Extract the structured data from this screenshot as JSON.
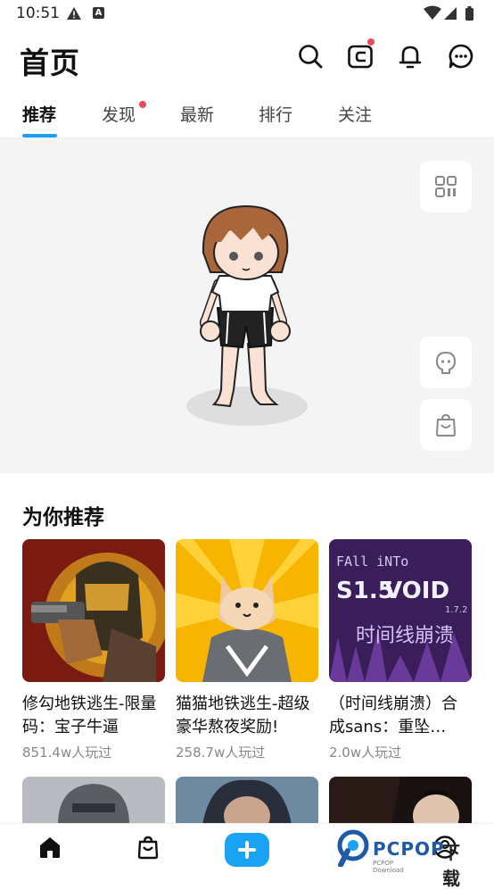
{
  "status_bar": {
    "time": "10:51"
  },
  "header": {
    "title": "首页"
  },
  "tabs": [
    {
      "label": "推荐",
      "active": true
    },
    {
      "label": "发现",
      "badge": true
    },
    {
      "label": "最新"
    },
    {
      "label": "排行"
    },
    {
      "label": "关注"
    }
  ],
  "recommend": {
    "title": "为你推荐",
    "cards": [
      {
        "title": "修勾地铁逃生-限量码：宝子牛逼",
        "plays": "851.4w人玩过"
      },
      {
        "title": "猫猫地铁逃生-超级豪华熬夜奖励!",
        "plays": "258.7w人玩过"
      },
      {
        "title": "（时间线崩溃）合成sans：重坠…",
        "plays": "2.0w人玩过"
      }
    ],
    "card3_art_text": {
      "line1": "FAll iNTo",
      "line2": "VOID",
      "ver": "S1.5",
      "sub": "1.7.2",
      "cn": "时间线崩溃"
    }
  },
  "watermark": {
    "brand": "PCPOP",
    "sub": "PCPOP Download",
    "download": "下载"
  },
  "colors": {
    "accent": "#1aa3f2",
    "badge": "#f04a5a"
  },
  "icons": {
    "header": [
      "search-icon",
      "wallet-icon",
      "bell-icon",
      "chat-icon"
    ],
    "side": [
      "qr-code-icon",
      "face-icon",
      "shop-bag-icon"
    ],
    "nav": [
      "home-icon",
      "bag-icon",
      "plus-icon",
      "profile-icon"
    ]
  }
}
